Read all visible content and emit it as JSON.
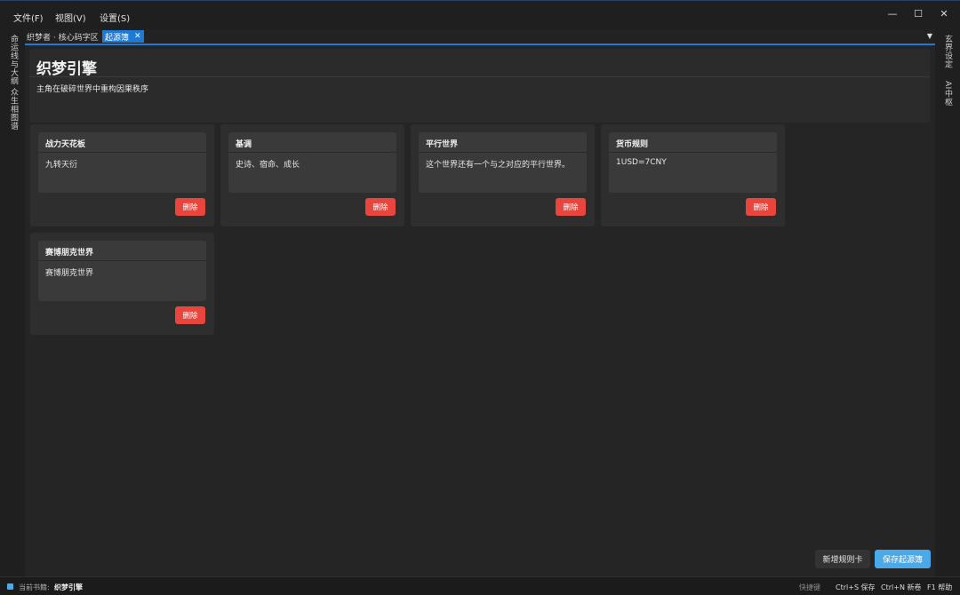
{
  "menu": {
    "file": "文件(F)",
    "view": "视图(V)",
    "settings": "设置(S)"
  },
  "window_controls": {
    "minimize": "—",
    "maximize": "☐",
    "close": "✕"
  },
  "left_dock": {
    "tab1": "命运线与大纲",
    "tab2": "众生相图谱"
  },
  "right_dock": {
    "tab1": "玄界设定",
    "tab2": "AI中枢"
  },
  "tabs": {
    "inactive_label": "织梦者 · 核心码字区",
    "active_label": "起源簿",
    "close_glyph": "✕",
    "menu_glyph": "▼"
  },
  "header": {
    "title": "织梦引擎",
    "description": "主角在破碎世界中重构因果秩序"
  },
  "cards": [
    {
      "title": "战力天花板",
      "body": "九转天衍",
      "delete_label": "删除"
    },
    {
      "title": "基调",
      "body": "史诗、宿命、成长",
      "delete_label": "删除"
    },
    {
      "title": "平行世界",
      "body": "这个世界还有一个与之对应的平行世界。",
      "delete_label": "删除"
    },
    {
      "title": "货币规则",
      "body": "1USD=7CNY",
      "delete_label": "删除"
    },
    {
      "title": "赛博朋克世界",
      "body": "赛博朋克世界",
      "delete_label": "删除"
    }
  ],
  "actions": {
    "add_card": "新增规则卡",
    "save": "保存起源簿"
  },
  "status": {
    "book_label": "当前书籍:",
    "book_name": "织梦引擎",
    "shortcuts_label": "快捷键",
    "save_shortcut": "Ctrl+S 保存",
    "new_shortcut": "Ctrl+N 新卷",
    "help_shortcut": "F1 帮助"
  },
  "colors": {
    "accent": "#1d7bd6",
    "danger": "#e8453c",
    "primary_button": "#4aa9e9"
  }
}
